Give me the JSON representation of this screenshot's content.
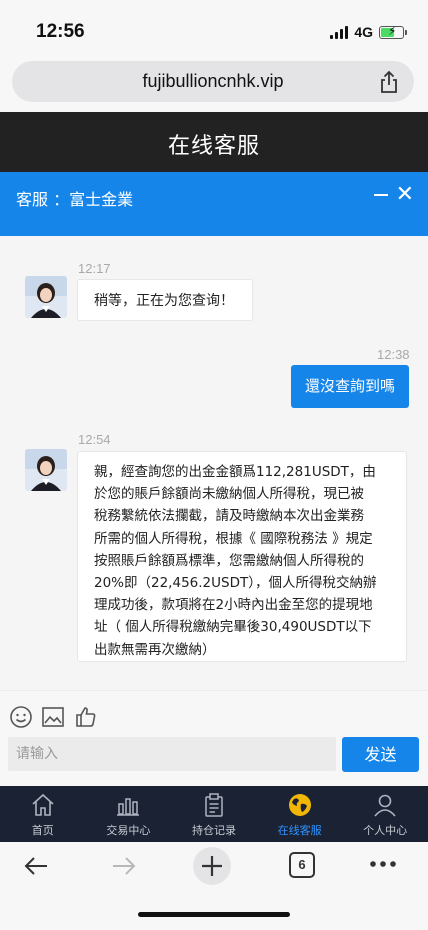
{
  "status_bar": {
    "time": "12:56",
    "network": "4G"
  },
  "browser": {
    "url": "fujibullioncnhk.vip",
    "tab_count": "6"
  },
  "page": {
    "title": "在线客服"
  },
  "service": {
    "label": "客服 ：富士金業"
  },
  "messages": [
    {
      "from": "agent",
      "time": "12:17",
      "lines": [
        "稍等，正在为您查询！"
      ]
    },
    {
      "from": "user",
      "time": "12:38",
      "lines": [
        "還沒查詢到嗎"
      ]
    },
    {
      "from": "agent",
      "time": "12:54",
      "lines": [
        "親，經查詢您的出金金額爲112,281USDT，由",
        "於您的賬戶餘額尚未繳納個人所得稅，現已被",
        "稅務繫統依法攔截，請及時繳納本次出金業務",
        "所需的個人所得稅，根據《 國際稅務法 》規定",
        "按照賬戶餘額爲標準，您需繳納個人所得稅的",
        "20%即（22,456.2USDT），個人所得稅交納辦",
        "理成功後，款項將在2小時內出金至您的提現地",
        "址（ 個人所得稅繳納完畢後30,490USDT以下",
        "出款無需再次繳納）"
      ]
    }
  ],
  "composer": {
    "placeholder": "请输入",
    "send_label": "发送"
  },
  "nav": {
    "items": [
      {
        "label": "首页"
      },
      {
        "label": "交易中心"
      },
      {
        "label": "持仓记录"
      },
      {
        "label": "在线客服"
      },
      {
        "label": "个人中心"
      }
    ]
  },
  "colors": {
    "accent": "#1585ea",
    "header": "#222222",
    "nav_bg": "#1a2234",
    "nav_active": "#2d93ff"
  },
  "icons": [
    "share-icon",
    "close-icon",
    "emoji-icon",
    "image-icon",
    "thumbs-up-icon",
    "home-icon",
    "chart-icon",
    "clipboard-icon",
    "globe-icon",
    "user-icon",
    "back-icon",
    "forward-icon",
    "plus-icon",
    "tabs-icon",
    "more-icon"
  ]
}
